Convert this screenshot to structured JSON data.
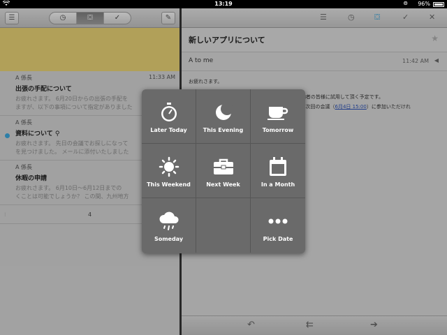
{
  "status_bar": {
    "time": "13:19",
    "battery": "96%"
  },
  "left_panel": {
    "segments": [
      "◷",
      "⛋",
      "✓"
    ],
    "mails": [
      {
        "from": "A 係長",
        "time": "11:33 AM",
        "subject": "出張の手配について",
        "preview_1": "お疲れさます。 6月20日からの出張の手配を",
        "preview_2": "ますが、以下の事項について指定がありました",
        "unread": false
      },
      {
        "from": "A 係長",
        "time": "",
        "subject": "資料について",
        "preview_1": "お疲れさます。 先日の会議でお探しになって",
        "preview_2": "を見つけました。 メールに添付いたしました",
        "unread": true
      },
      {
        "from": "A 係長",
        "time": "",
        "subject": "休暇の申請",
        "preview_1": "お疲れさます。 6月10日〜6月12日までの",
        "preview_2": "くことは可能でしょうか？ この間、九州地方",
        "unread": false
      }
    ],
    "count": "4"
  },
  "right_panel": {
    "subject": "新しいアプリについて",
    "from": "A to me",
    "time": "11:42 AM",
    "greeting": "お疲れさます。",
    "line1": "現在開発中の新しいアプリですが、次回の会議で参加者の皆様に試用して頂く予定です。",
    "line2a": "つきまして準備をお願い致しますので、ご確認の上、次回の会議（",
    "link": "6月4日 15:00",
    "line2b": "）に参加いただけれ"
  },
  "snooze_popup": {
    "options": [
      {
        "label": "Later Today",
        "icon": "stopwatch-icon"
      },
      {
        "label": "This Evening",
        "icon": "moon-icon"
      },
      {
        "label": "Tomorrow",
        "icon": "coffee-cup-icon"
      },
      {
        "label": "This Weekend",
        "icon": "sun-icon"
      },
      {
        "label": "Next Week",
        "icon": "briefcase-icon"
      },
      {
        "label": "In a Month",
        "icon": "calendar-icon"
      },
      {
        "label": "Someday",
        "icon": "rain-cloud-icon"
      },
      {
        "label": "",
        "icon": ""
      },
      {
        "label": "Pick Date",
        "icon": "more-dots-icon"
      }
    ]
  },
  "colors": {
    "accent": "#3a9fd3",
    "yellow_band": "#e3cd72",
    "popup": "#6a6a6a"
  }
}
